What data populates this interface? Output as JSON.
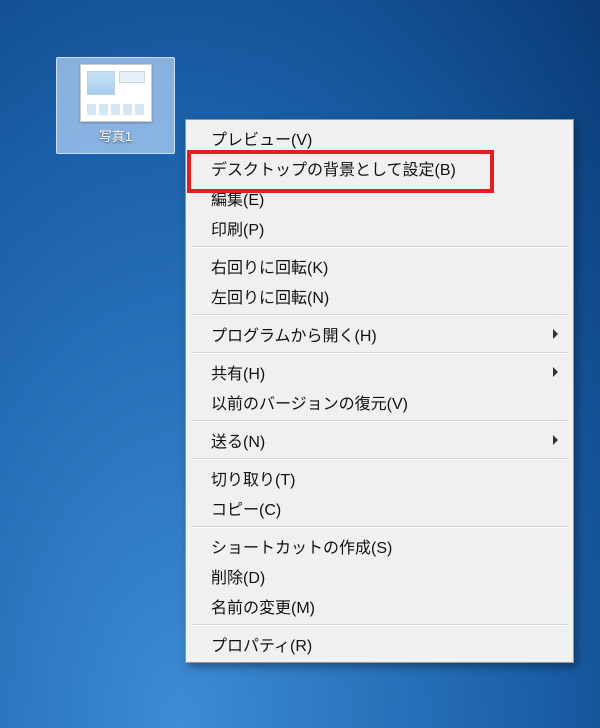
{
  "desktop_icon": {
    "label": "写真1"
  },
  "context_menu": {
    "groups": [
      [
        {
          "label": "プレビュー(V)",
          "submenu": false
        },
        {
          "label": "デスクトップの背景として設定(B)",
          "submenu": false,
          "highlighted": true
        },
        {
          "label": "編集(E)",
          "submenu": false
        },
        {
          "label": "印刷(P)",
          "submenu": false
        }
      ],
      [
        {
          "label": "右回りに回転(K)",
          "submenu": false
        },
        {
          "label": "左回りに回転(N)",
          "submenu": false
        }
      ],
      [
        {
          "label": "プログラムから開く(H)",
          "submenu": true
        }
      ],
      [
        {
          "label": "共有(H)",
          "submenu": true
        },
        {
          "label": "以前のバージョンの復元(V)",
          "submenu": false
        }
      ],
      [
        {
          "label": "送る(N)",
          "submenu": true
        }
      ],
      [
        {
          "label": "切り取り(T)",
          "submenu": false
        },
        {
          "label": "コピー(C)",
          "submenu": false
        }
      ],
      [
        {
          "label": "ショートカットの作成(S)",
          "submenu": false
        },
        {
          "label": "削除(D)",
          "submenu": false
        },
        {
          "label": "名前の変更(M)",
          "submenu": false
        }
      ],
      [
        {
          "label": "プロパティ(R)",
          "submenu": false
        }
      ]
    ]
  },
  "colors": {
    "highlight_border": "#e02020"
  }
}
